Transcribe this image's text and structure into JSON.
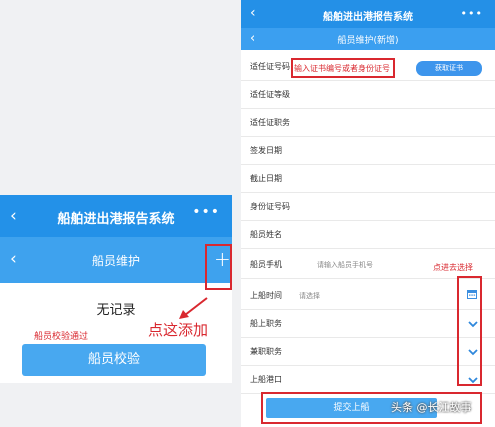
{
  "left_screen": {
    "title": "船舶进出港报告系统",
    "more": "•••",
    "back": "‹",
    "subtitle": "船员维护",
    "add": "+",
    "no_records": "无记录",
    "status_text": "船员校验通过",
    "verify_button": "船员校验",
    "hint": "点这添加"
  },
  "right_screen": {
    "title": "船舶进出港报告系统",
    "more": "•••",
    "back": "‹",
    "subtitle": "船员维护(新增)",
    "fields": {
      "cert_no": "适任证号码",
      "cert_level": "适任证等级",
      "cert_duty": "适任证职务",
      "issue_date": "签发日期",
      "expire_date": "截止日期",
      "id_no": "身份证号码",
      "name": "船员姓名",
      "phone": "船员手机",
      "board_time": "上船时间",
      "board_duty": "船上职务",
      "part_time_duty": "兼职职务",
      "board_port": "上船港口"
    },
    "cert_input_hint": "输入证书编号或者身份证号",
    "get_cert_button": "获取证书",
    "phone_placeholder": "请输入船员手机号",
    "board_time_placeholder": "请选择",
    "select_hint": "点进去选择",
    "submit_button": "提交上船"
  },
  "watermark": "头条 @长江故事",
  "colors": {
    "title_blue": "#2490e7",
    "sub_blue": "#3ea2ee",
    "button_blue": "#48a8f0",
    "annotation_red": "#d9282f"
  }
}
